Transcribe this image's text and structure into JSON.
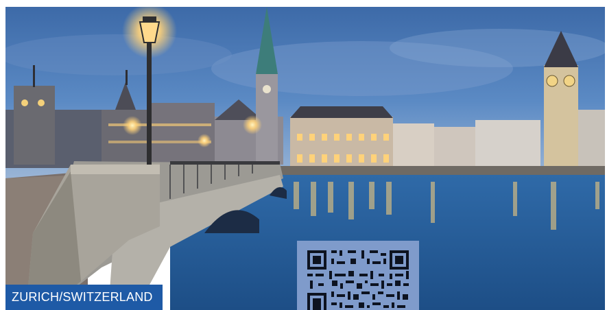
{
  "photo": {
    "subject": "zurich-limmat-river-night",
    "colors": {
      "sky": "#4e7fc0",
      "water": "#2a5f9a",
      "lamp": "#ffd27a",
      "caption_bg": "#1e5aa6",
      "qr_bg": "#7f9bcb"
    }
  },
  "caption": {
    "text": "ZURICH/SWITZERLAND"
  },
  "qr": {
    "icon": "qr-code-icon"
  }
}
